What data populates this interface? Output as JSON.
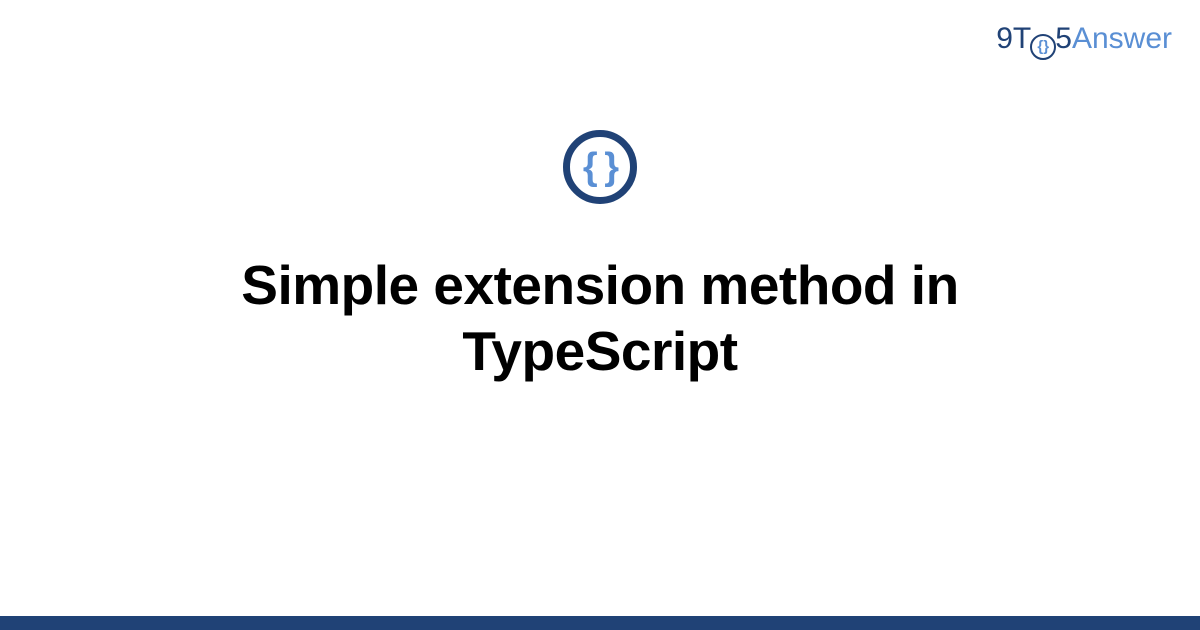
{
  "logo": {
    "part_9t": "9T",
    "part_braces": "{}",
    "part_5": "5",
    "part_answer": "Answer"
  },
  "icon": {
    "braces": "{ }"
  },
  "title": "Simple extension method in TypeScript",
  "colors": {
    "primary": "#204276",
    "accent": "#5a8fd4"
  }
}
